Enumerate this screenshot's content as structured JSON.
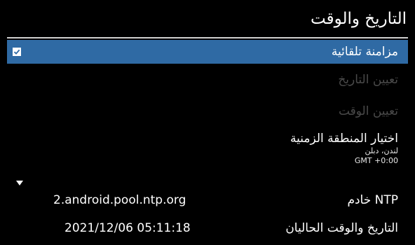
{
  "header": {
    "title": "التاريخ والوقت"
  },
  "items": {
    "auto_sync": {
      "label": "مزامنة تلقائية",
      "checked": true
    },
    "set_date": {
      "label": "تعيين التاريخ"
    },
    "set_time": {
      "label": "تعيين الوقت"
    },
    "timezone": {
      "label": "اختيار المنطقة الزمنية",
      "city": "لندن، دبلن",
      "offset": "GMT +0:00"
    }
  },
  "ntp": {
    "label": "خادم NTP",
    "value": "2.android.pool.ntp.org"
  },
  "current_time": {
    "label": "التاريخ والوقت الحاليان",
    "value": "2021/12/06 05:11:18"
  },
  "colors": {
    "selection": "#2f6aa4",
    "disabled_text": "#4a4a4a",
    "background": "#000000"
  },
  "icons": {
    "checkbox": "checkbox-checked-icon",
    "scroll": "down-arrow-icon"
  }
}
